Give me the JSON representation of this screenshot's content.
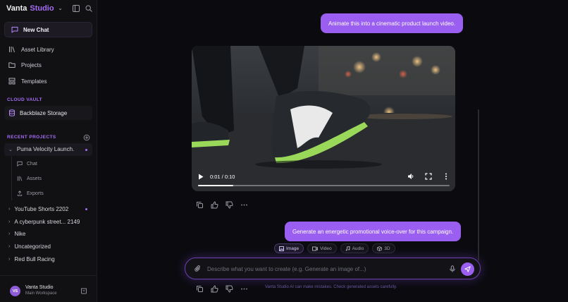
{
  "brand": {
    "part1": "Vanta",
    "part2": "Studio"
  },
  "sidebar": {
    "new_chat": "New Chat",
    "nav": [
      {
        "label": "Asset Library",
        "icon": "library-icon"
      },
      {
        "label": "Projects",
        "icon": "folder-icon"
      },
      {
        "label": "Templates",
        "icon": "templates-icon"
      }
    ],
    "cloud_vault_title": "CLOUD VAULT",
    "vault_item": "Backblaze Storage",
    "recent_title": "RECENT PROJECTS",
    "active_project": "Puma Velocity Launch.",
    "sub_items": [
      "Chat",
      "Assets",
      "Exports"
    ],
    "projects": [
      "YouTube Shorts 2202",
      "A cyberpunk street... 2149",
      "Nike",
      "Uncategorized",
      "Red Bull Racing"
    ]
  },
  "user": {
    "initials": "VS",
    "name": "Vanta Studio",
    "workspace": "Main Workspace"
  },
  "messages": {
    "first": "Animate this into a cinematic product launch video.",
    "second": "Generate an energetic promotional voice-over for this campaign."
  },
  "video": {
    "time": "0:01 / 0:10",
    "progress": 0.14
  },
  "chips": [
    "Image",
    "Video",
    "Audio",
    "3D"
  ],
  "prompt": {
    "placeholder": "Describe what you want to create (e.g. Generate an image of...)"
  },
  "disclaimer": "Vanta Studio AI can make mistakes. Check generated assets carefully.",
  "colors": {
    "accent": "#9a5ef0",
    "background": "#0b0b0f",
    "sidebar": "#111114"
  }
}
